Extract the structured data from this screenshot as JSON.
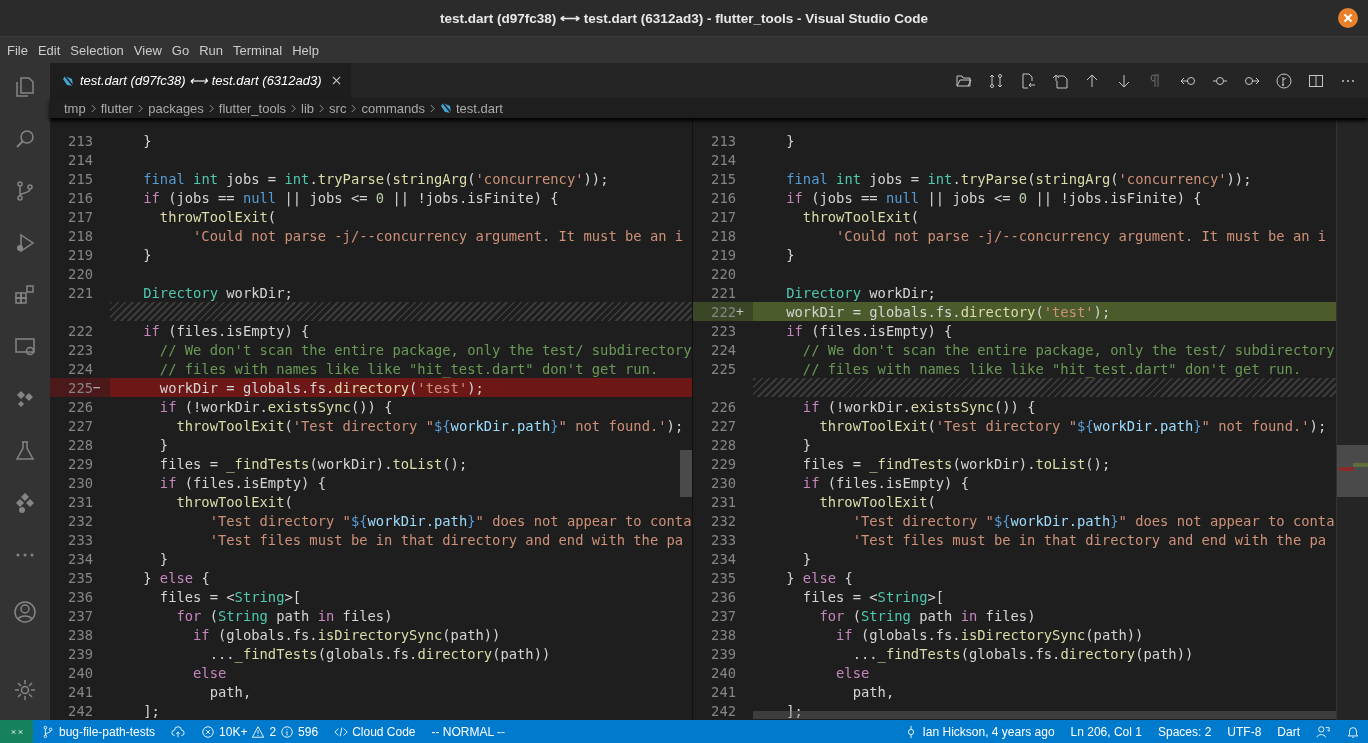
{
  "window": {
    "title": "test.dart (d97fc38) ⟷ test.dart (6312ad3) - flutter_tools - Visual Studio Code"
  },
  "menu": [
    "File",
    "Edit",
    "Selection",
    "View",
    "Go",
    "Run",
    "Terminal",
    "Help"
  ],
  "tabs": [
    {
      "label": "test.dart (d97fc38) ⟷ test.dart (6312ad3)",
      "selected": true
    }
  ],
  "breadcrumbs": [
    {
      "label": "tmp",
      "kind": "folder"
    },
    {
      "label": "flutter",
      "kind": "folder"
    },
    {
      "label": "packages",
      "kind": "folder"
    },
    {
      "label": "flutter_tools",
      "kind": "folder"
    },
    {
      "label": "lib",
      "kind": "folder"
    },
    {
      "label": "src",
      "kind": "folder"
    },
    {
      "label": "commands",
      "kind": "folder"
    },
    {
      "label": "test.dart",
      "kind": "file"
    }
  ],
  "diff": {
    "left": {
      "lines": [
        {
          "num": "213",
          "kind": "normal",
          "tokens": [
            {
              "kind": "p",
              "t": "    }"
            }
          ]
        },
        {
          "num": "214",
          "kind": "normal"
        },
        {
          "num": "215",
          "kind": "normal",
          "tokens": [
            {
              "kind": "kw",
              "t": "    final"
            },
            {
              "kind": "ty",
              "t": " int"
            },
            {
              "kind": "p",
              "t": " jobs = "
            },
            {
              "kind": "ty",
              "t": "int"
            },
            {
              "kind": "p",
              "t": "."
            },
            {
              "kind": "fn",
              "t": "tryParse"
            },
            {
              "kind": "p",
              "t": "("
            },
            {
              "kind": "fn",
              "t": "stringArg"
            },
            {
              "kind": "p",
              "t": "("
            },
            {
              "kind": "str",
              "t": "'concurrency'"
            },
            {
              "kind": "p",
              "t": "));"
            }
          ]
        },
        {
          "num": "216",
          "kind": "normal",
          "tokens": [
            {
              "kind": "ctl",
              "t": "    if"
            },
            {
              "kind": "p",
              "t": " (jobs == "
            },
            {
              "kind": "kw",
              "t": "null"
            },
            {
              "kind": "p",
              "t": " || jobs <= "
            },
            {
              "kind": "num",
              "t": "0"
            },
            {
              "kind": "p",
              "t": " || !jobs.isFinite) {"
            }
          ]
        },
        {
          "num": "217",
          "kind": "normal",
          "tokens": [
            {
              "kind": "fn",
              "t": "      throwToolExit"
            },
            {
              "kind": "p",
              "t": "("
            }
          ]
        },
        {
          "num": "218",
          "kind": "normal",
          "tokens": [
            {
              "kind": "str",
              "t": "          'Could not parse -j/--concurrency argument. It must be an i"
            }
          ]
        },
        {
          "num": "219",
          "kind": "normal",
          "tokens": [
            {
              "kind": "p",
              "t": "    }"
            }
          ]
        },
        {
          "num": "220",
          "kind": "normal"
        },
        {
          "num": "221",
          "kind": "normal",
          "tokens": [
            {
              "kind": "ty",
              "t": "    Directory"
            },
            {
              "kind": "p",
              "t": " workDir;"
            }
          ]
        },
        {
          "kind": "filler"
        },
        {
          "num": "222",
          "kind": "normal",
          "tokens": [
            {
              "kind": "ctl",
              "t": "    if"
            },
            {
              "kind": "p",
              "t": " (files.isEmpty) {"
            }
          ]
        },
        {
          "num": "223",
          "kind": "normal",
          "tokens": [
            {
              "kind": "cm",
              "t": "      // We don't scan the entire package, only the test/ subdirectory"
            }
          ]
        },
        {
          "num": "224",
          "kind": "normal",
          "tokens": [
            {
              "kind": "cm",
              "t": "      // files with names like like \"hit_test.dart\" don't get run."
            }
          ]
        },
        {
          "num": "225",
          "kind": "removed",
          "sign": "−",
          "tokens": [
            {
              "kind": "p",
              "t": "      workDir = globals.fs."
            },
            {
              "kind": "fn",
              "t": "directory"
            },
            {
              "kind": "p",
              "t": "("
            },
            {
              "kind": "str",
              "t": "'test'"
            },
            {
              "kind": "p",
              "t": ");"
            }
          ]
        },
        {
          "num": "226",
          "kind": "normal",
          "tokens": [
            {
              "kind": "ctl",
              "t": "      if"
            },
            {
              "kind": "p",
              "t": " (!workDir."
            },
            {
              "kind": "fn",
              "t": "existsSync"
            },
            {
              "kind": "p",
              "t": "()) {"
            }
          ]
        },
        {
          "num": "227",
          "kind": "normal",
          "tokens": [
            {
              "kind": "fn",
              "t": "        throwToolExit"
            },
            {
              "kind": "p",
              "t": "("
            },
            {
              "kind": "str",
              "t": "'Test directory \""
            },
            {
              "kind": "kw",
              "t": "${"
            },
            {
              "kind": "var",
              "t": "workDir.path"
            },
            {
              "kind": "kw",
              "t": "}"
            },
            {
              "kind": "str",
              "t": "\" not found.'"
            },
            {
              "kind": "p",
              "t": ");"
            }
          ]
        },
        {
          "num": "228",
          "kind": "normal",
          "tokens": [
            {
              "kind": "p",
              "t": "      }"
            }
          ]
        },
        {
          "num": "229",
          "kind": "normal",
          "tokens": [
            {
              "kind": "p",
              "t": "      files = "
            },
            {
              "kind": "fn",
              "t": "_findTests"
            },
            {
              "kind": "p",
              "t": "(workDir)."
            },
            {
              "kind": "fn",
              "t": "toList"
            },
            {
              "kind": "p",
              "t": "();"
            }
          ]
        },
        {
          "num": "230",
          "kind": "normal",
          "tokens": [
            {
              "kind": "ctl",
              "t": "      if"
            },
            {
              "kind": "p",
              "t": " (files.isEmpty) {"
            }
          ]
        },
        {
          "num": "231",
          "kind": "normal",
          "tokens": [
            {
              "kind": "fn",
              "t": "        throwToolExit"
            },
            {
              "kind": "p",
              "t": "("
            }
          ]
        },
        {
          "num": "232",
          "kind": "normal",
          "tokens": [
            {
              "kind": "str",
              "t": "            'Test directory \""
            },
            {
              "kind": "kw",
              "t": "${"
            },
            {
              "kind": "var",
              "t": "workDir.path"
            },
            {
              "kind": "kw",
              "t": "}"
            },
            {
              "kind": "str",
              "t": "\" does not appear to conta"
            }
          ]
        },
        {
          "num": "233",
          "kind": "normal",
          "tokens": [
            {
              "kind": "str",
              "t": "            'Test files must be in that directory and end with the pa"
            }
          ]
        },
        {
          "num": "234",
          "kind": "normal",
          "tokens": [
            {
              "kind": "p",
              "t": "      }"
            }
          ]
        },
        {
          "num": "235",
          "kind": "normal",
          "tokens": [
            {
              "kind": "p",
              "t": "    } "
            },
            {
              "kind": "ctl",
              "t": "else"
            },
            {
              "kind": "p",
              "t": " {"
            }
          ]
        },
        {
          "num": "236",
          "kind": "normal",
          "tokens": [
            {
              "kind": "p",
              "t": "      files = <"
            },
            {
              "kind": "ty",
              "t": "String"
            },
            {
              "kind": "p",
              "t": ">["
            }
          ]
        },
        {
          "num": "237",
          "kind": "normal",
          "tokens": [
            {
              "kind": "ctl",
              "t": "        for"
            },
            {
              "kind": "p",
              "t": " ("
            },
            {
              "kind": "ty",
              "t": "String"
            },
            {
              "kind": "p",
              "t": " path "
            },
            {
              "kind": "ctl",
              "t": "in"
            },
            {
              "kind": "p",
              "t": " files)"
            }
          ]
        },
        {
          "num": "238",
          "kind": "normal",
          "tokens": [
            {
              "kind": "ctl",
              "t": "          if"
            },
            {
              "kind": "p",
              "t": " (globals.fs."
            },
            {
              "kind": "fn",
              "t": "isDirectorySync"
            },
            {
              "kind": "p",
              "t": "(path))"
            }
          ]
        },
        {
          "num": "239",
          "kind": "normal",
          "tokens": [
            {
              "kind": "p",
              "t": "            ..."
            },
            {
              "kind": "fn",
              "t": "_findTests"
            },
            {
              "kind": "p",
              "t": "(globals.fs."
            },
            {
              "kind": "fn",
              "t": "directory"
            },
            {
              "kind": "p",
              "t": "(path))"
            }
          ]
        },
        {
          "num": "240",
          "kind": "normal",
          "tokens": [
            {
              "kind": "ctl",
              "t": "          else"
            }
          ]
        },
        {
          "num": "241",
          "kind": "normal",
          "tokens": [
            {
              "kind": "p",
              "t": "            path,"
            }
          ]
        },
        {
          "num": "242",
          "kind": "normal",
          "tokens": [
            {
              "kind": "p",
              "t": "    ];"
            }
          ]
        }
      ]
    },
    "right": {
      "lines": [
        {
          "num": "213",
          "kind": "normal",
          "tokens": [
            {
              "kind": "p",
              "t": "    }"
            }
          ]
        },
        {
          "num": "214",
          "kind": "normal"
        },
        {
          "num": "215",
          "kind": "normal",
          "tokens": [
            {
              "kind": "kw",
              "t": "    final"
            },
            {
              "kind": "ty",
              "t": " int"
            },
            {
              "kind": "p",
              "t": " jobs = "
            },
            {
              "kind": "ty",
              "t": "int"
            },
            {
              "kind": "p",
              "t": "."
            },
            {
              "kind": "fn",
              "t": "tryParse"
            },
            {
              "kind": "p",
              "t": "("
            },
            {
              "kind": "fn",
              "t": "stringArg"
            },
            {
              "kind": "p",
              "t": "("
            },
            {
              "kind": "str",
              "t": "'concurrency'"
            },
            {
              "kind": "p",
              "t": "));"
            }
          ]
        },
        {
          "num": "216",
          "kind": "normal",
          "tokens": [
            {
              "kind": "ctl",
              "t": "    if"
            },
            {
              "kind": "p",
              "t": " (jobs == "
            },
            {
              "kind": "kw",
              "t": "null"
            },
            {
              "kind": "p",
              "t": " || jobs <= "
            },
            {
              "kind": "num",
              "t": "0"
            },
            {
              "kind": "p",
              "t": " || !jobs.isFinite) {"
            }
          ]
        },
        {
          "num": "217",
          "kind": "normal",
          "tokens": [
            {
              "kind": "fn",
              "t": "      throwToolExit"
            },
            {
              "kind": "p",
              "t": "("
            }
          ]
        },
        {
          "num": "218",
          "kind": "normal",
          "tokens": [
            {
              "kind": "str",
              "t": "          'Could not parse -j/--concurrency argument. It must be an i"
            }
          ]
        },
        {
          "num": "219",
          "kind": "normal",
          "tokens": [
            {
              "kind": "p",
              "t": "    }"
            }
          ]
        },
        {
          "num": "220",
          "kind": "normal"
        },
        {
          "num": "221",
          "kind": "normal",
          "tokens": [
            {
              "kind": "ty",
              "t": "    Directory"
            },
            {
              "kind": "p",
              "t": " workDir;"
            }
          ]
        },
        {
          "num": "222",
          "kind": "added",
          "sign": "+",
          "tokens": [
            {
              "kind": "p",
              "t": "    workDir = globals.fs."
            },
            {
              "kind": "fn",
              "t": "directory"
            },
            {
              "kind": "p",
              "t": "("
            },
            {
              "kind": "str",
              "t": "'test'"
            },
            {
              "kind": "p",
              "t": ");"
            }
          ]
        },
        {
          "num": "223",
          "kind": "normal",
          "tokens": [
            {
              "kind": "ctl",
              "t": "    if"
            },
            {
              "kind": "p",
              "t": " (files.isEmpty) {"
            }
          ]
        },
        {
          "num": "224",
          "kind": "normal",
          "tokens": [
            {
              "kind": "cm",
              "t": "      // We don't scan the entire package, only the test/ subdirectory"
            }
          ]
        },
        {
          "num": "225",
          "kind": "normal",
          "tokens": [
            {
              "kind": "cm",
              "t": "      // files with names like like \"hit_test.dart\" don't get run."
            }
          ]
        },
        {
          "kind": "filler"
        },
        {
          "num": "226",
          "kind": "normal",
          "tokens": [
            {
              "kind": "ctl",
              "t": "      if"
            },
            {
              "kind": "p",
              "t": " (!workDir."
            },
            {
              "kind": "fn",
              "t": "existsSync"
            },
            {
              "kind": "p",
              "t": "()) {"
            }
          ]
        },
        {
          "num": "227",
          "kind": "normal",
          "tokens": [
            {
              "kind": "fn",
              "t": "        throwToolExit"
            },
            {
              "kind": "p",
              "t": "("
            },
            {
              "kind": "str",
              "t": "'Test directory \""
            },
            {
              "kind": "kw",
              "t": "${"
            },
            {
              "kind": "var",
              "t": "workDir.path"
            },
            {
              "kind": "kw",
              "t": "}"
            },
            {
              "kind": "str",
              "t": "\" not found.'"
            },
            {
              "kind": "p",
              "t": ");"
            }
          ]
        },
        {
          "num": "228",
          "kind": "normal",
          "tokens": [
            {
              "kind": "p",
              "t": "      }"
            }
          ]
        },
        {
          "num": "229",
          "kind": "normal",
          "tokens": [
            {
              "kind": "p",
              "t": "      files = "
            },
            {
              "kind": "fn",
              "t": "_findTests"
            },
            {
              "kind": "p",
              "t": "(workDir)."
            },
            {
              "kind": "fn",
              "t": "toList"
            },
            {
              "kind": "p",
              "t": "();"
            }
          ]
        },
        {
          "num": "230",
          "kind": "normal",
          "tokens": [
            {
              "kind": "ctl",
              "t": "      if"
            },
            {
              "kind": "p",
              "t": " (files.isEmpty) {"
            }
          ]
        },
        {
          "num": "231",
          "kind": "normal",
          "tokens": [
            {
              "kind": "fn",
              "t": "        throwToolExit"
            },
            {
              "kind": "p",
              "t": "("
            }
          ]
        },
        {
          "num": "232",
          "kind": "normal",
          "tokens": [
            {
              "kind": "str",
              "t": "            'Test directory \""
            },
            {
              "kind": "kw",
              "t": "${"
            },
            {
              "kind": "var",
              "t": "workDir.path"
            },
            {
              "kind": "kw",
              "t": "}"
            },
            {
              "kind": "str",
              "t": "\" does not appear to conta"
            }
          ]
        },
        {
          "num": "233",
          "kind": "normal",
          "tokens": [
            {
              "kind": "str",
              "t": "            'Test files must be in that directory and end with the pa"
            }
          ]
        },
        {
          "num": "234",
          "kind": "normal",
          "tokens": [
            {
              "kind": "p",
              "t": "      }"
            }
          ]
        },
        {
          "num": "235",
          "kind": "normal",
          "tokens": [
            {
              "kind": "p",
              "t": "    } "
            },
            {
              "kind": "ctl",
              "t": "else"
            },
            {
              "kind": "p",
              "t": " {"
            }
          ]
        },
        {
          "num": "236",
          "kind": "normal",
          "tokens": [
            {
              "kind": "p",
              "t": "      files = <"
            },
            {
              "kind": "ty",
              "t": "String"
            },
            {
              "kind": "p",
              "t": ">["
            }
          ]
        },
        {
          "num": "237",
          "kind": "normal",
          "tokens": [
            {
              "kind": "ctl",
              "t": "        for"
            },
            {
              "kind": "p",
              "t": " ("
            },
            {
              "kind": "ty",
              "t": "String"
            },
            {
              "kind": "p",
              "t": " path "
            },
            {
              "kind": "ctl",
              "t": "in"
            },
            {
              "kind": "p",
              "t": " files)"
            }
          ]
        },
        {
          "num": "238",
          "kind": "normal",
          "tokens": [
            {
              "kind": "ctl",
              "t": "          if"
            },
            {
              "kind": "p",
              "t": " (globals.fs."
            },
            {
              "kind": "fn",
              "t": "isDirectorySync"
            },
            {
              "kind": "p",
              "t": "(path))"
            }
          ]
        },
        {
          "num": "239",
          "kind": "normal",
          "tokens": [
            {
              "kind": "p",
              "t": "            ..."
            },
            {
              "kind": "fn",
              "t": "_findTests"
            },
            {
              "kind": "p",
              "t": "(globals.fs."
            },
            {
              "kind": "fn",
              "t": "directory"
            },
            {
              "kind": "p",
              "t": "(path))"
            }
          ]
        },
        {
          "num": "240",
          "kind": "normal",
          "tokens": [
            {
              "kind": "ctl",
              "t": "          else"
            }
          ]
        },
        {
          "num": "241",
          "kind": "normal",
          "tokens": [
            {
              "kind": "p",
              "t": "            path,"
            }
          ]
        },
        {
          "num": "242",
          "kind": "normal",
          "tokens": [
            {
              "kind": "p",
              "t": "    ];"
            }
          ]
        }
      ]
    }
  },
  "status_bar": {
    "branch": "bug-file-path-tests",
    "errors": "10K+",
    "warnings": "2",
    "infos": "596",
    "cloud_code": "Cloud Code",
    "mode": "-- NORMAL --",
    "blame": "Ian Hickson, 4 years ago",
    "position": "Ln 206, Col 1",
    "spaces": "Spaces: 2",
    "encoding": "UTF-8",
    "language": "Dart"
  }
}
